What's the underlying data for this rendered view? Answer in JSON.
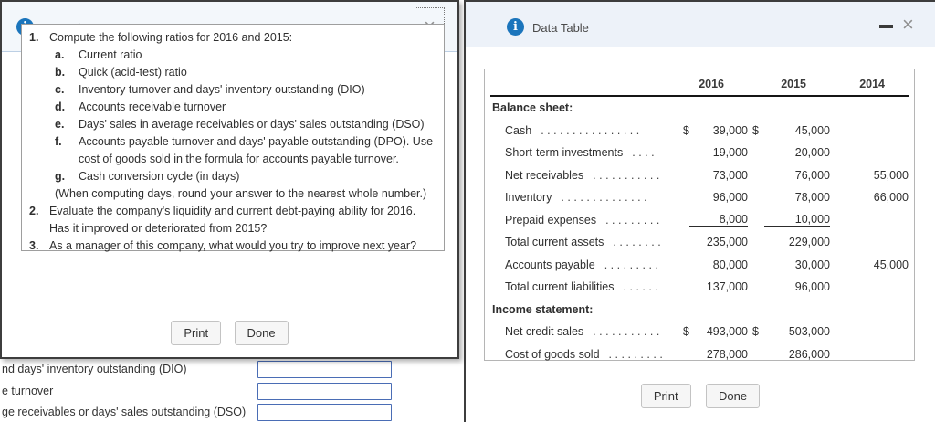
{
  "icons": {
    "info": "i",
    "close": "×"
  },
  "colors": {
    "accent_blue": "#1b75bc",
    "header_bg": "#edf2f9",
    "dialog_border": "#3d3d3d",
    "input_border": "#4a6db5",
    "table_border": "#b5b5b5"
  },
  "requirements_dialog": {
    "title": "Requirements",
    "items": [
      {
        "num": "1.",
        "text": "Compute the following ratios for 2016 and 2015:"
      },
      {
        "num": "2.",
        "text": "Evaluate the company's liquidity and current debt-paying ability for 2016. Has it improved or deteriorated from 2015?"
      },
      {
        "num": "3.",
        "text": "As a manager of this company, what would you try to improve next year?"
      }
    ],
    "sub_items": [
      {
        "letter": "a.",
        "text": "Current ratio"
      },
      {
        "letter": "b.",
        "text": "Quick (acid-test) ratio"
      },
      {
        "letter": "c.",
        "text": "Inventory turnover and days' inventory outstanding (DIO)"
      },
      {
        "letter": "d.",
        "text": "Accounts receivable turnover"
      },
      {
        "letter": "e.",
        "text": "Days' sales in average receivables or days' sales outstanding (DSO)"
      },
      {
        "letter": "f.",
        "text": "Accounts payable turnover and days' payable outstanding (DPO). Use cost of goods sold in the formula for accounts payable turnover."
      },
      {
        "letter": "g.",
        "text": "Cash conversion cycle (in days)"
      }
    ],
    "note": "(When computing days, round your answer to the nearest whole number.)",
    "buttons": {
      "print": "Print",
      "done": "Done"
    }
  },
  "data_table_dialog": {
    "title": "Data Table",
    "years": [
      "2016",
      "2015",
      "2014"
    ],
    "section_balance": "Balance sheet:",
    "section_income": "Income statement:",
    "rows": [
      {
        "label": "Cash",
        "dots": "................",
        "pre": "$",
        "v2016": "39,000",
        "mid": "$",
        "v2015": "45,000",
        "v2014": ""
      },
      {
        "label": "Short-term investments",
        "dots": "....",
        "pre": "",
        "v2016": "19,000",
        "mid": "",
        "v2015": "20,000",
        "v2014": ""
      },
      {
        "label": "Net receivables",
        "dots": "...........",
        "pre": "",
        "v2016": "73,000",
        "mid": "",
        "v2015": "76,000",
        "v2014": "55,000"
      },
      {
        "label": "Inventory",
        "dots": "..............",
        "pre": "",
        "v2016": "96,000",
        "mid": "",
        "v2015": "78,000",
        "v2014": "66,000"
      },
      {
        "label": "Prepaid expenses",
        "dots": ".........",
        "pre": "",
        "v2016": "8,000",
        "mid": "",
        "v2015": "10,000",
        "v2014": ""
      },
      {
        "label": "Total current assets",
        "dots": "........",
        "pre": "",
        "v2016": "235,000",
        "mid": "",
        "v2015": "229,000",
        "v2014": ""
      },
      {
        "label": "Accounts payable",
        "dots": ".........",
        "pre": "",
        "v2016": "80,000",
        "mid": "",
        "v2015": "30,000",
        "v2014": "45,000"
      },
      {
        "label": "Total current liabilities",
        "dots": "......",
        "pre": "",
        "v2016": "137,000",
        "mid": "",
        "v2015": "96,000",
        "v2014": ""
      },
      {
        "label": "Net credit sales",
        "dots": "...........",
        "pre": "$",
        "v2016": "493,000",
        "mid": "$",
        "v2015": "503,000",
        "v2014": ""
      },
      {
        "label": "Cost of goods sold",
        "dots": ".........",
        "pre": "",
        "v2016": "278,000",
        "mid": "",
        "v2015": "286,000",
        "v2014": ""
      }
    ],
    "buttons": {
      "print": "Print",
      "done": "Done"
    }
  },
  "background": {
    "labels": [
      "nd days' inventory outstanding (DIO)",
      "e turnover",
      "ge receivables or days' sales outstanding (DSO)"
    ]
  }
}
